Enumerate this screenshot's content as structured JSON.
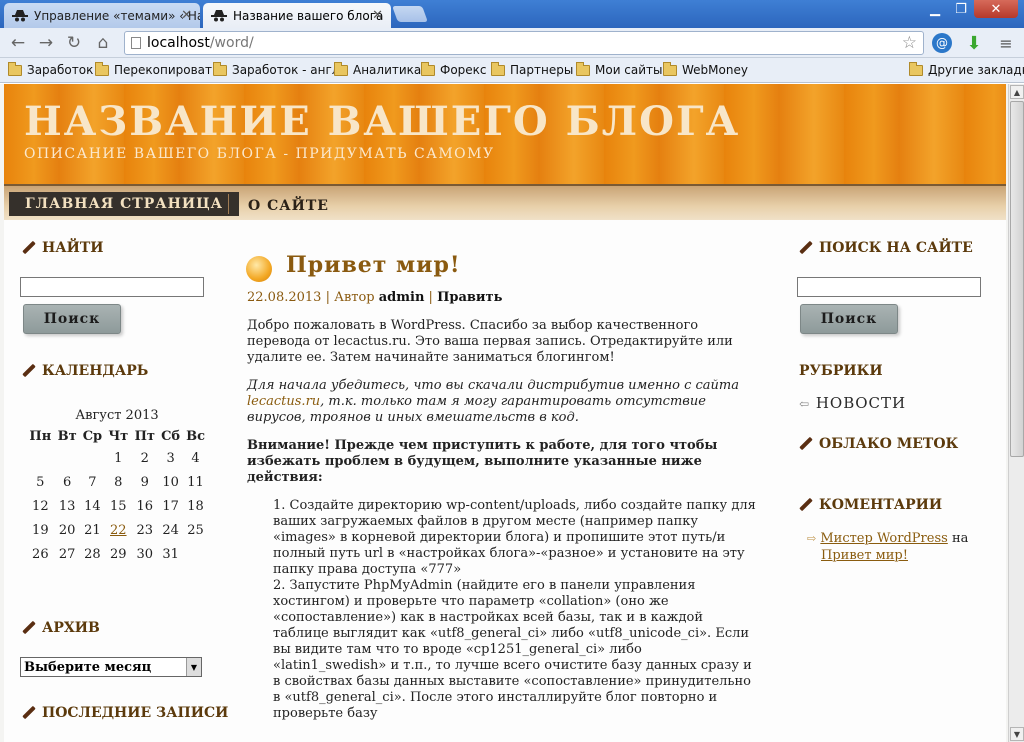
{
  "browser": {
    "tabs": [
      {
        "title": "Управление «темами» ‹ Наз",
        "active": false
      },
      {
        "title": "Название вашего блога",
        "active": true
      }
    ],
    "url_host": "localhost",
    "url_path": "/word/",
    "bookmarks": [
      "Заработок",
      "Перекопировать",
      "Заработок - англ",
      "Аналитика",
      "Форекс",
      "Партнеры",
      "Мои сайты",
      "WebMoney"
    ],
    "other_bookmarks": "Другие закладки"
  },
  "header": {
    "title": "НАЗВАНИЕ ВАШЕГО БЛОГА",
    "description": "ОПИСАНИЕ ВАШЕГО БЛОГА - ПРИДУМАТЬ САМОМУ"
  },
  "nav": {
    "home": "ГЛАВНАЯ СТРАНИЦА",
    "about": "О САЙТЕ"
  },
  "left_sidebar": {
    "search_title": "НАЙТИ",
    "search_button": "Поиск",
    "calendar_title": "КАЛЕНДАРЬ",
    "calendar": {
      "caption": "Август 2013",
      "days": [
        "Пн",
        "Вт",
        "Ср",
        "Чт",
        "Пт",
        "Сб",
        "Вс"
      ],
      "weeks": [
        [
          "",
          "",
          "",
          "1",
          "2",
          "3",
          "4"
        ],
        [
          "5",
          "6",
          "7",
          "8",
          "9",
          "10",
          "11"
        ],
        [
          "12",
          "13",
          "14",
          "15",
          "16",
          "17",
          "18"
        ],
        [
          "19",
          "20",
          "21",
          "22",
          "23",
          "24",
          "25"
        ],
        [
          "26",
          "27",
          "28",
          "29",
          "30",
          "31",
          ""
        ]
      ],
      "today": "22"
    },
    "archive_title": "АРХИВ",
    "archive_select": "Выберите месяц",
    "recent_title": "ПОСЛЕДНИЕ ЗАПИСИ"
  },
  "post": {
    "title": "Привет мир!",
    "date": "22.08.2013",
    "author_label": "Автор",
    "author": "admin",
    "edit": "Править",
    "p1": "Добро пожаловать в WordPress. Спасибо за выбор качественного перевода от lecactus.ru. Это ваша первая запись. Отредактируйте или удалите ее. Затем начинайте заниматься блогингом!",
    "p2_before": "Для начала убедитесь, что вы скачали дистрибутив именно с сайта ",
    "p2_link": "lecactus.ru",
    "p2_after": ", т.к. только там я могу гарантировать отсутствие вирусов, троянов и иных вмешательств в код.",
    "warning": "Внимание! Прежде чем приступить к работе, для того чтобы избежать проблем в будущем, выполните указанные ниже действия:",
    "step1": "1. Создайте директорию wp-content/uploads, либо создайте папку для ваших загружаемых файлов в другом месте (например папку «images» в корневой директории блога) и пропишите этот путь/и полный путь url в «настройках блога»-«разное» и установите на эту папку права доступа «777»",
    "step2": "2. Запустите PhpMyAdmin (найдите его в панели управления хостингом) и проверьте что параметр «collation» (оно же «сопоставление») как в настройках всей базы, так и в каждой таблице выглядит как «utf8_general_ci» либо «utf8_unicode_ci». Если вы видите там что то вроде «cp1251_general_ci» либо «latin1_swedish» и т.п., то лучше всего очистите базу данных сразу и в свойствах базы данных выставите «сопоставление» принудительно в «utf8_general_ci». После этого инсталлируйте блог повторно и проверьте базу"
  },
  "right_sidebar": {
    "search_title": "ПОИСК НА САЙТЕ",
    "search_button": "Поиск",
    "categories_title": "РУБРИКИ",
    "category_item": "НОВОСТИ",
    "tags_title": "ОБЛАКО МЕТОК",
    "comments_title": "КОМЕНТАРИИ",
    "comment_author": "Мистер WordPress",
    "comment_on": "на",
    "comment_post": "Привет мир!"
  }
}
